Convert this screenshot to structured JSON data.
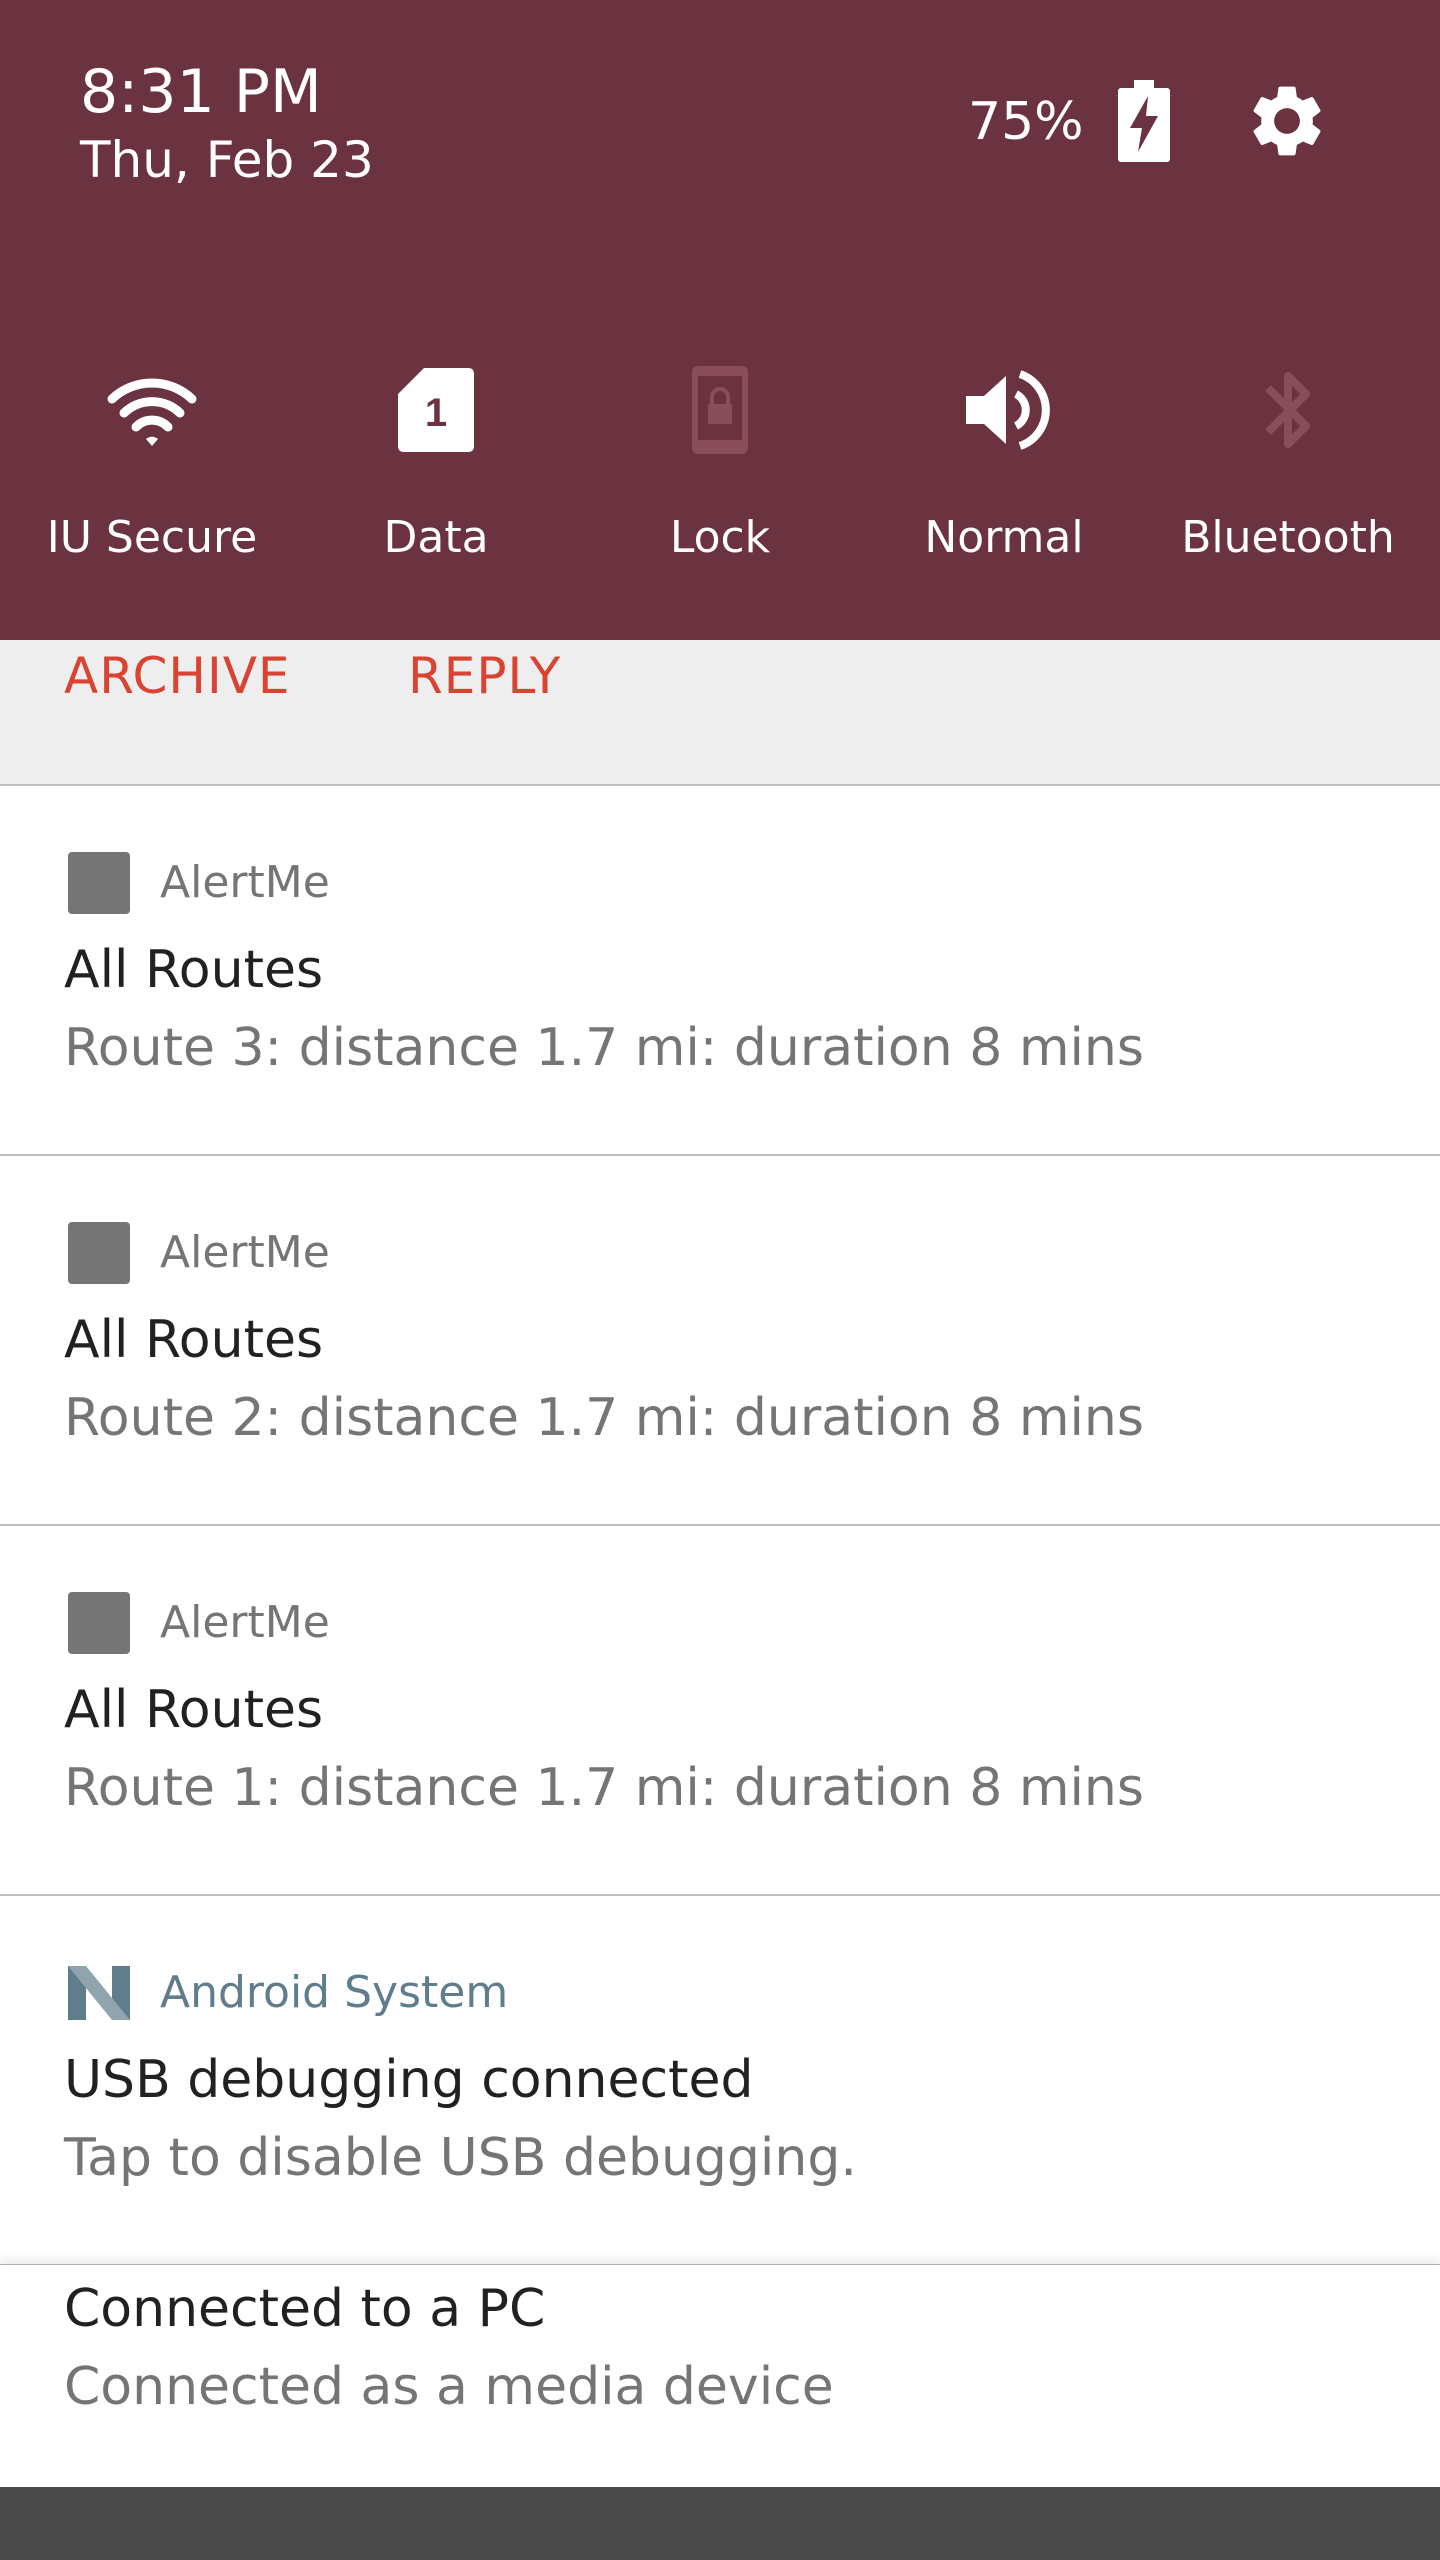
{
  "status": {
    "time": "8:31 PM",
    "date": "Thu, Feb 23",
    "battery_percent": "75%",
    "battery_icon": "battery-charging-icon",
    "settings_icon": "gear-icon"
  },
  "colors": {
    "header_bg": "#6b3340",
    "action_accent": "#d84332",
    "system_app_name": "#607d8b"
  },
  "quick_tiles": [
    {
      "label": "IU Secure",
      "icon": "wifi-icon",
      "active": true
    },
    {
      "label": "Data",
      "icon": "sim-card-icon",
      "sim_number": "1",
      "active": true
    },
    {
      "label": "Lock",
      "icon": "screen-lock-icon",
      "active": false
    },
    {
      "label": "Normal",
      "icon": "volume-icon",
      "active": true
    },
    {
      "label": "Bluetooth",
      "icon": "bluetooth-icon",
      "active": false
    }
  ],
  "actions": {
    "archive": "ARCHIVE",
    "reply": "REPLY"
  },
  "notifications": [
    {
      "app": "AlertMe",
      "title": "All Routes",
      "text": "Route 3: distance 1.7 mi: duration 8 mins"
    },
    {
      "app": "AlertMe",
      "title": "All Routes",
      "text": "Route 2: distance 1.7 mi: duration 8 mins"
    },
    {
      "app": "AlertMe",
      "title": "All Routes",
      "text": "Route 1: distance 1.7 mi: duration 8 mins"
    },
    {
      "app": "Android System",
      "title": "USB debugging connected",
      "text": "Tap to disable USB debugging."
    }
  ],
  "usb_notification": {
    "title": "Connected to a PC",
    "text": "Connected as a media device"
  }
}
